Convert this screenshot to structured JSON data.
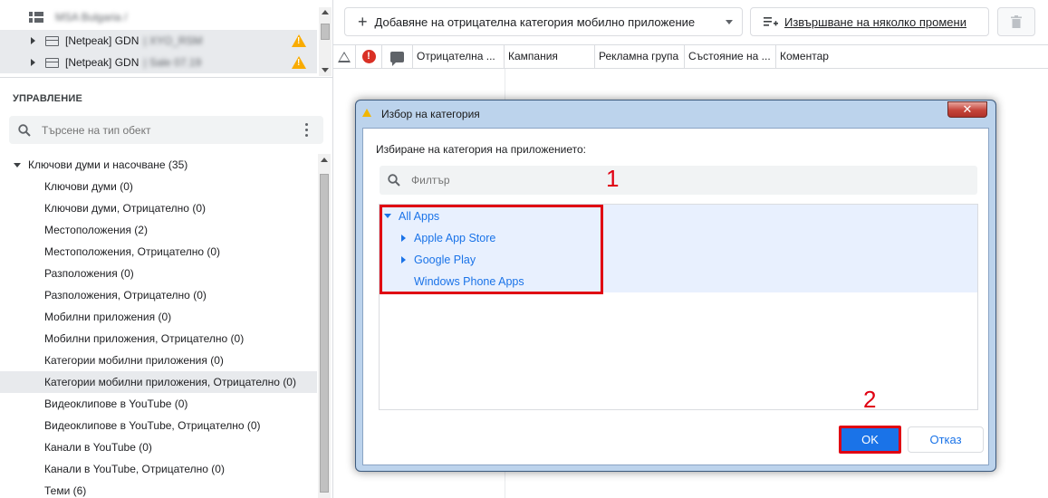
{
  "account_tree": {
    "root_label": "MSA Bulgaria /",
    "rows": [
      {
        "label": "[Netpeak] GDN",
        "suffix": "| XYO_RSM"
      },
      {
        "label": "[Netpeak] GDN",
        "suffix": "| Sale 07.19"
      }
    ]
  },
  "management": {
    "header": "УПРАВЛЕНИЕ",
    "search_placeholder": "Търсене на тип обект"
  },
  "object_tree": {
    "group": "Ключови думи и насочване (35)",
    "items": [
      "Ключови думи (0)",
      "Ключови думи, Отрицателно (0)",
      "Местоположения (2)",
      "Местоположения, Отрицателно (0)",
      "Разположения (0)",
      "Разположения, Отрицателно (0)",
      "Мобилни приложения (0)",
      "Мобилни приложения, Отрицателно (0)",
      "Категории мобилни приложения (0)",
      "Категории мобилни приложения, Отрицателно (0)",
      "Видеоклипове в YouTube (0)",
      "Видеоклипове в YouTube, Отрицателно (0)",
      "Канали в YouTube (0)",
      "Канали в YouTube, Отрицателно (0)",
      "Теми (6)"
    ],
    "selected_index": 9
  },
  "toolbar": {
    "add_negative_label": "Добавяне на отрицателна категория мобилно приложение",
    "multiple_changes_label": "Извършване на няколко промени"
  },
  "grid": {
    "columns": [
      "Отрицателна ...",
      "Кампания",
      "Рекламна група",
      "Състояние на ...",
      "Коментар"
    ]
  },
  "dialog": {
    "title": "Избор на категория",
    "close_glyph": "✕",
    "prompt": "Избиране на категория на приложението:",
    "filter_placeholder": "Филтър",
    "tree": {
      "root": "All Apps",
      "children": [
        "Apple App Store",
        "Google Play",
        "Windows Phone Apps"
      ]
    },
    "ok_label": "OK",
    "cancel_label": "Отказ",
    "annotation_1": "1",
    "annotation_2": "2"
  },
  "colors": {
    "accent": "#1a73e8",
    "annotation_red": "#e00012",
    "warning": "#f9ab00",
    "error": "#d93025",
    "selection": "#e8eaed",
    "dialog_frame": "#bcd3ec"
  }
}
